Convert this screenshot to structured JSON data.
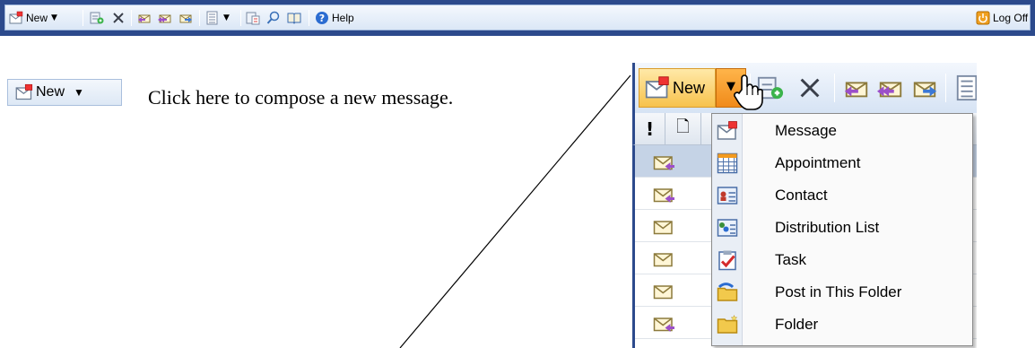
{
  "toolbar": {
    "new_label": "New",
    "help_label": "Help",
    "logoff_label": "Log Off",
    "icons": [
      "new-mail-icon",
      "move-icon",
      "delete-icon",
      "reply-icon",
      "reply-all-icon",
      "forward-icon",
      "view-icon",
      "check-names-icon",
      "find-icon",
      "address-book-icon",
      "help-icon",
      "logoff-icon"
    ]
  },
  "new_button": {
    "label": "New"
  },
  "instruction": {
    "text": "Click here to compose a new message."
  },
  "zoom": {
    "new_label": "New",
    "column_headers": [
      "!",
      "🗋"
    ],
    "menu": {
      "items": [
        {
          "label": "Message",
          "icon": "message-icon"
        },
        {
          "label": "Appointment",
          "icon": "appointment-icon"
        },
        {
          "label": "Contact",
          "icon": "contact-icon"
        },
        {
          "label": "Distribution List",
          "icon": "distribution-list-icon"
        },
        {
          "label": "Task",
          "icon": "task-icon"
        },
        {
          "label": "Post in This Folder",
          "icon": "post-icon"
        },
        {
          "label": "Folder",
          "icon": "folder-icon"
        }
      ]
    }
  },
  "colors": {
    "toolbar_frame": "#2c4a8c",
    "hover_orange": "#f7c24c",
    "menu_border": "#8a8a8a"
  }
}
